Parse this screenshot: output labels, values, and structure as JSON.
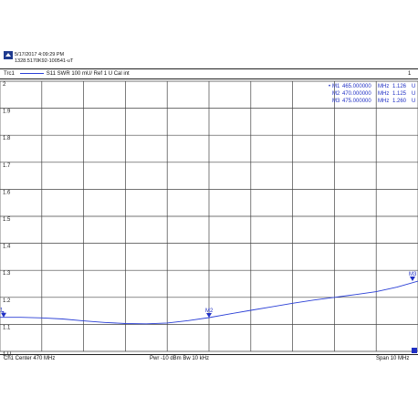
{
  "header": {
    "datetime": "5/17/2017 4:09:29 PM",
    "instrument_id": "1328.5170K92-100541-uT",
    "trace_name": "Trc1",
    "trace_desc": "S11  SWR  100 mU/ Ref 1 U  Cal int",
    "channel_index": "1"
  },
  "colors": {
    "trace": "#2a3fd6",
    "grid": "#444444",
    "marker_text": "#1f2fc4"
  },
  "markers": [
    {
      "name": "M1",
      "freq": "465.000000",
      "unit": "MHz",
      "value": "1.126",
      "vunit": "U",
      "active": true
    },
    {
      "name": "M2",
      "freq": "470.000000",
      "unit": "MHz",
      "value": "1.125",
      "vunit": "U",
      "active": false
    },
    {
      "name": "M3",
      "freq": "475.000000",
      "unit": "MHz",
      "value": "1.260",
      "vunit": "U",
      "active": false
    }
  ],
  "footer": {
    "left": "Ch1  Center  470 MHz",
    "center": "Pwr  -10 dBm  Bw  10 kHz",
    "right": "Span  10 MHz"
  },
  "chart_data": {
    "type": "line",
    "ylim": [
      1.0,
      2.0
    ],
    "xlim": [
      465,
      475
    ],
    "ytick_labels": [
      "2",
      "1.9",
      "1.8",
      "1.7",
      "1.6",
      "1.5",
      "1.4",
      "1.3",
      "1.2",
      "1.1",
      "1 U"
    ],
    "grid": true,
    "series": [
      {
        "x": [
          465,
          465.5,
          466,
          466.5,
          467,
          467.5,
          468,
          468.5,
          469,
          469.5,
          470,
          470.5,
          471,
          471.5,
          472,
          472.5,
          473,
          473.5,
          474,
          474.5,
          475
        ],
        "y": [
          1.126,
          1.126,
          1.124,
          1.12,
          1.113,
          1.107,
          1.103,
          1.102,
          1.105,
          1.114,
          1.125,
          1.139,
          1.152,
          1.165,
          1.178,
          1.19,
          1.2,
          1.21,
          1.221,
          1.238,
          1.26
        ]
      }
    ],
    "marker_points": [
      {
        "label": "1",
        "x": 465,
        "y": 1.126
      },
      {
        "label": "M2",
        "x": 470,
        "y": 1.125
      },
      {
        "label": "M3",
        "x": 475,
        "y": 1.26
      }
    ],
    "ref_marker": "1"
  }
}
